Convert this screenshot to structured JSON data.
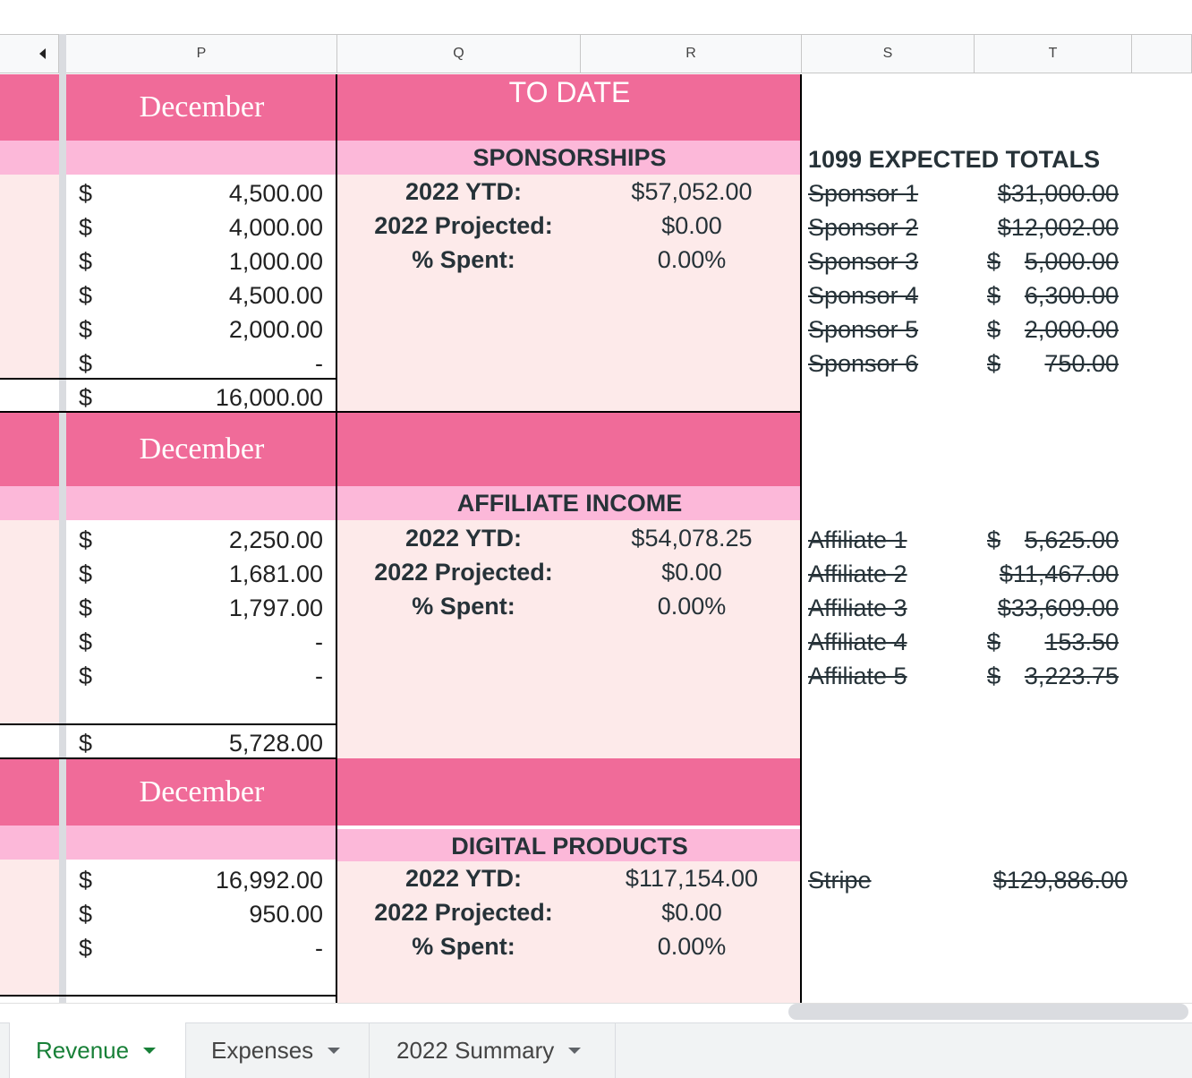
{
  "column_headers": [
    "P",
    "Q",
    "R",
    "S",
    "T"
  ],
  "sections": [
    {
      "month": "December",
      "header_title": "TO DATE",
      "name": "SPONSORSHIPS",
      "amounts": [
        "4,500.00",
        "4,000.00",
        "1,000.00",
        "4,500.00",
        "2,000.00",
        "-"
      ],
      "total": "16,000.00",
      "ytd_label": "2022 YTD:",
      "ytd": "$57,052.00",
      "proj_label": "2022 Projected:",
      "proj": "$0.00",
      "spent_label": "% Spent:",
      "spent": "0.00%"
    },
    {
      "month": "December",
      "name": "AFFILIATE INCOME",
      "amounts": [
        "2,250.00",
        "1,681.00",
        "1,797.00",
        "-",
        "-"
      ],
      "total": "5,728.00",
      "ytd_label": "2022 YTD:",
      "ytd": "$54,078.25",
      "proj_label": "2022 Projected:",
      "proj": "$0.00",
      "spent_label": "% Spent:",
      "spent": "0.00%"
    },
    {
      "month": "December",
      "name": "DIGITAL PRODUCTS",
      "amounts": [
        "16,992.00",
        "950.00",
        "-"
      ],
      "ytd_label": "2022 YTD:",
      "ytd": "$117,154.00",
      "proj_label": "2022 Projected:",
      "proj": "$0.00",
      "spent_label": "% Spent:",
      "spent": "0.00%"
    }
  ],
  "currency_symbol": "$",
  "expected_totals": {
    "title": "1099 EXPECTED TOTALS",
    "sponsors": [
      {
        "name": "Sponsor 1",
        "cur": "",
        "amount": "$31,000.00"
      },
      {
        "name": "Sponsor 2",
        "cur": "",
        "amount": "$12,002.00"
      },
      {
        "name": "Sponsor 3",
        "cur": "$",
        "amount": "5,000.00"
      },
      {
        "name": "Sponsor 4",
        "cur": "$",
        "amount": "6,300.00"
      },
      {
        "name": "Sponsor 5",
        "cur": "$",
        "amount": "2,000.00"
      },
      {
        "name": "Sponsor 6",
        "cur": "$",
        "amount": "750.00"
      }
    ],
    "affiliates": [
      {
        "name": "Affiliate 1",
        "cur": "$",
        "amount": "5,625.00"
      },
      {
        "name": "Affiliate 2",
        "cur": "",
        "amount": "$11,467.00"
      },
      {
        "name": "Affiliate 3",
        "cur": "",
        "amount": "$33,609.00"
      },
      {
        "name": "Affiliate 4",
        "cur": "$",
        "amount": "153.50"
      },
      {
        "name": "Affiliate 5",
        "cur": "$",
        "amount": "3,223.75"
      }
    ],
    "stripe": {
      "name": "Stripe",
      "amount": "$129,886.00"
    }
  },
  "sheet_tabs": [
    {
      "label": "Revenue",
      "active": true
    },
    {
      "label": "Expenses",
      "active": false
    },
    {
      "label": "2022 Summary",
      "active": false
    }
  ],
  "colors": {
    "pink_dark": "#f06b99",
    "pink_light": "#fcb8d9",
    "pink_pale": "#fdeaea",
    "active_tab": "#188038"
  }
}
